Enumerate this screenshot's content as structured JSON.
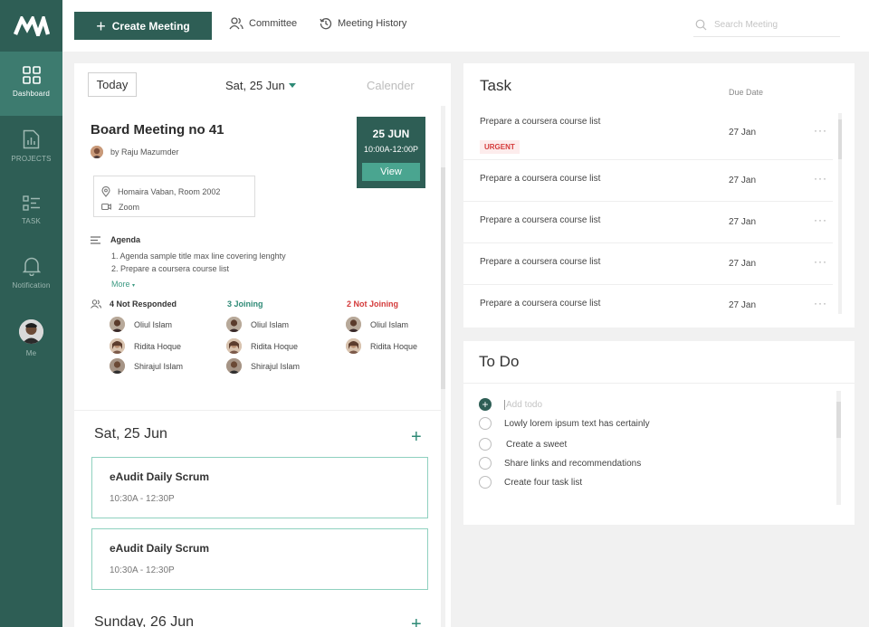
{
  "sidebar": {
    "logo_text": "MV",
    "items": [
      {
        "label": "Dashboard",
        "icon": "grid-icon"
      },
      {
        "label": "PROJECTS",
        "icon": "chart-file-icon"
      },
      {
        "label": "TASK",
        "icon": "task-list-icon"
      },
      {
        "label": "Notification",
        "icon": "bell-icon"
      },
      {
        "label": "Me",
        "icon": "avatar"
      }
    ]
  },
  "topbar": {
    "create_label": "Create Meeting",
    "committee_label": "Committee",
    "history_label": "Meeting History",
    "search_placeholder": "Search Meeting"
  },
  "calendar": {
    "today_label": "Today",
    "selected_date": "Sat, 25 Jun",
    "calender_label": "Calender"
  },
  "meeting": {
    "title": "Board Meeting no 41",
    "by": "by Raju Mazumder",
    "date": "25 JUN",
    "time": "10:00A-12:00P",
    "view_label": "View",
    "location": "Homaira Vaban, Room 2002",
    "platform": "Zoom",
    "agenda_label": "Agenda",
    "agenda_items": [
      "1. Agenda sample title max line covering lenghty",
      "2. Prepare a coursera course list"
    ],
    "more_label": "More",
    "not_responded": {
      "label": "4 Not Responded",
      "people": [
        "Oliul Islam",
        "Ridita Hoque",
        "Shirajul Islam"
      ]
    },
    "joining": {
      "label": "3 Joining",
      "people": [
        "Oliul Islam",
        "Ridita Hoque",
        "Shirajul Islam"
      ]
    },
    "not_joining": {
      "label": "2 Not Joining",
      "people": [
        "Oliul Islam",
        "Ridita Hoque"
      ]
    }
  },
  "schedule": [
    {
      "date": "Sat, 25 Jun",
      "events": [
        {
          "title": "eAudit Daily Scrum",
          "time": "10:30A - 12:30P"
        },
        {
          "title": "eAudit Daily Scrum",
          "time": "10:30A - 12:30P"
        }
      ]
    },
    {
      "date": "Sunday, 26 Jun",
      "events": []
    }
  ],
  "tasks": {
    "title": "Task",
    "due_label": "Due Date",
    "items": [
      {
        "text": "Prepare a coursera course list",
        "due": "27 Jan",
        "badge": "URGENT"
      },
      {
        "text": "Prepare a coursera course list",
        "due": "27 Jan"
      },
      {
        "text": "Prepare a coursera course list",
        "due": "27 Jan"
      },
      {
        "text": "Prepare a coursera course list",
        "due": "27 Jan"
      },
      {
        "text": "Prepare a coursera course list",
        "due": "27 Jan"
      }
    ],
    "more_glyph": "···"
  },
  "todo": {
    "title": "To Do",
    "add_placeholder": "Add todo",
    "items": [
      "Lowly lorem ipsum text has certainly",
      "Create a sweet",
      "Share links and recommendations",
      "Create four task list"
    ]
  },
  "colors": {
    "brand": "#2e5e55",
    "accent": "#3d9a83",
    "joining": "#2e8a76",
    "not_joining": "#d43a3a",
    "urgent": "#d43a3a"
  }
}
